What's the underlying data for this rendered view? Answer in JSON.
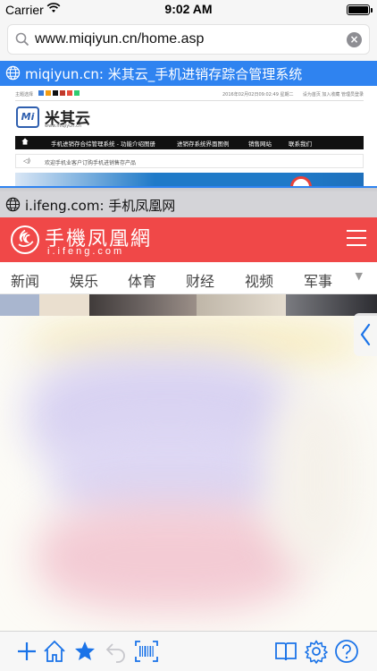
{
  "status_bar": {
    "carrier": "Carrier",
    "time": "9:02 AM"
  },
  "url_bar": {
    "url": "www.miqiyun.cn/home.asp",
    "clear_icon": "clear-icon"
  },
  "tab1": {
    "title": "miqiyun.cn: 米其云_手机进销存踪合管理系统"
  },
  "miqiyun_page": {
    "theme_label": "主题选择",
    "theme_colors": [
      "#3a7bd5",
      "#f39c12",
      "#111111",
      "#c0392b",
      "#e74c3c",
      "#2ecc71"
    ],
    "date_text": "2016年02月02日09:02:49 星期二",
    "top_links": "设为首页  加入收藏      管理员登录",
    "brand": "米其云",
    "brand_sub": "www.miqiyun.cn",
    "nav": [
      "手机进销存合综管理系统 - 功能介绍图册",
      "进销存系统界面图例",
      "销售网站",
      "联系我们"
    ],
    "notice": "欢迎手机业客户订购手机进销售存产品"
  },
  "tab2": {
    "title": "i.ifeng.com: 手机凤凰网"
  },
  "ifeng_page": {
    "logo_cn": "手機凤凰網",
    "logo_en": "i.ifeng.com",
    "tabs": [
      "新闻",
      "娱乐",
      "体育",
      "财经",
      "视频",
      "军事"
    ],
    "more_icon": "chevron-down-icon"
  },
  "toolbar": {
    "icons": [
      "plus-icon",
      "home-icon",
      "star-icon",
      "back-icon",
      "barcode-icon",
      "book-icon",
      "gear-icon",
      "help-icon"
    ],
    "accent": "#1a73e8"
  }
}
